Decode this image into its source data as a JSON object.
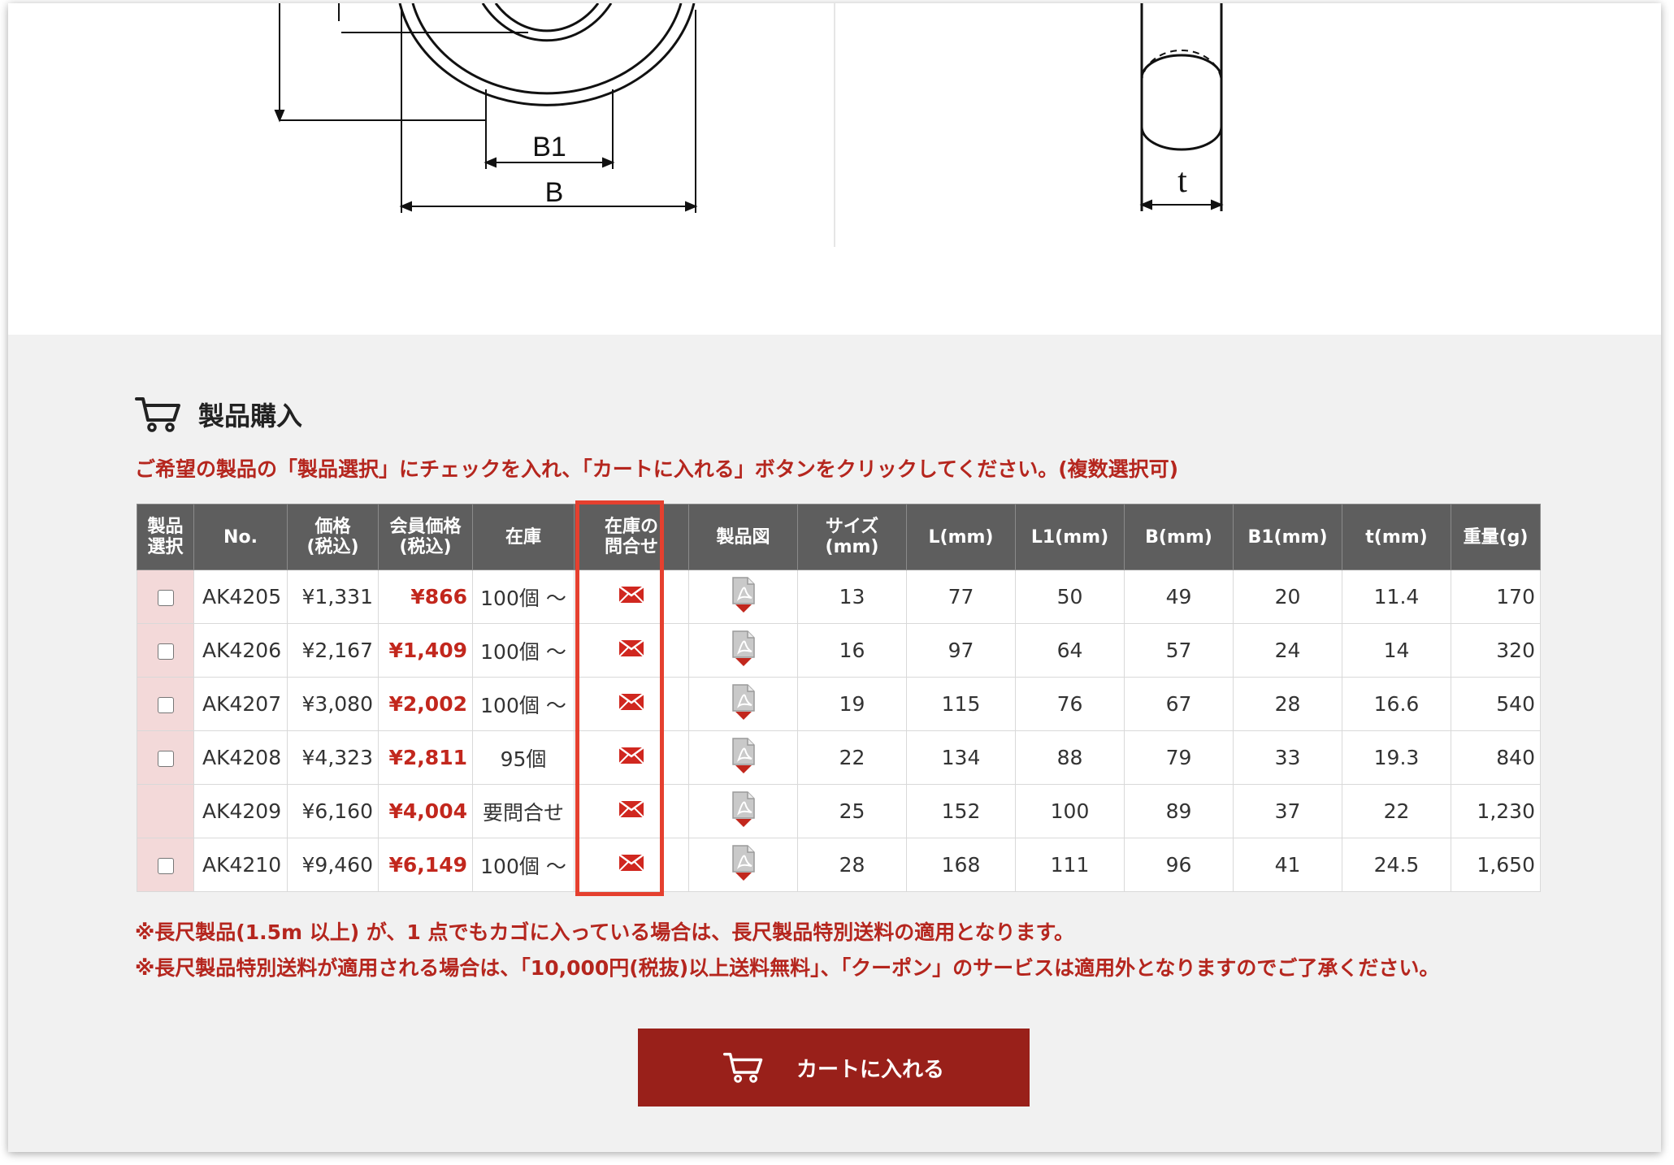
{
  "drawing": {
    "labels": {
      "b1": "B1",
      "b": "B",
      "t": "t"
    }
  },
  "purchase": {
    "heading": "製品購入",
    "instructions": "ご希望の製品の「製品選択」にチェックを入れ、「カートに入れる」ボタンをクリックしてください。(複数選択可)",
    "columns": [
      {
        "line1": "製品",
        "line2": "選択"
      },
      {
        "line1": "No.",
        "line2": ""
      },
      {
        "line1": "価格",
        "line2": "(税込)"
      },
      {
        "line1": "会員価格",
        "line2": "(税込)"
      },
      {
        "line1": "在庫",
        "line2": ""
      },
      {
        "line1": "在庫の",
        "line2": "問合せ"
      },
      {
        "line1": "製品図",
        "line2": ""
      },
      {
        "line1": "サイズ",
        "line2": "(mm)"
      },
      {
        "line1": "L(mm)",
        "line2": ""
      },
      {
        "line1": "L1(mm)",
        "line2": ""
      },
      {
        "line1": "B(mm)",
        "line2": ""
      },
      {
        "line1": "B1(mm)",
        "line2": ""
      },
      {
        "line1": "t(mm)",
        "line2": ""
      },
      {
        "line1": "重量(g)",
        "line2": ""
      }
    ],
    "rows": [
      {
        "has_checkbox": true,
        "no": "AK4205",
        "price": "¥1,331",
        "member_price": "¥866",
        "stock": "100個 ～",
        "size": "13",
        "l": "77",
        "l1": "50",
        "b": "49",
        "b1": "20",
        "t": "11.4",
        "weight": "170"
      },
      {
        "has_checkbox": true,
        "no": "AK4206",
        "price": "¥2,167",
        "member_price": "¥1,409",
        "stock": "100個 ～",
        "size": "16",
        "l": "97",
        "l1": "64",
        "b": "57",
        "b1": "24",
        "t": "14",
        "weight": "320"
      },
      {
        "has_checkbox": true,
        "no": "AK4207",
        "price": "¥3,080",
        "member_price": "¥2,002",
        "stock": "100個 ～",
        "size": "19",
        "l": "115",
        "l1": "76",
        "b": "67",
        "b1": "28",
        "t": "16.6",
        "weight": "540"
      },
      {
        "has_checkbox": true,
        "no": "AK4208",
        "price": "¥4,323",
        "member_price": "¥2,811",
        "stock": "95個",
        "size": "22",
        "l": "134",
        "l1": "88",
        "b": "79",
        "b1": "33",
        "t": "19.3",
        "weight": "840"
      },
      {
        "has_checkbox": false,
        "no": "AK4209",
        "price": "¥6,160",
        "member_price": "¥4,004",
        "stock": "要問合せ",
        "size": "25",
        "l": "152",
        "l1": "100",
        "b": "89",
        "b1": "37",
        "t": "22",
        "weight": "1,230"
      },
      {
        "has_checkbox": true,
        "no": "AK4210",
        "price": "¥9,460",
        "member_price": "¥6,149",
        "stock": "100個 ～",
        "size": "28",
        "l": "168",
        "l1": "111",
        "b": "96",
        "b1": "41",
        "t": "24.5",
        "weight": "1,650"
      }
    ],
    "notes": [
      "※長尺製品(1.5m 以上) が、1 点でもカゴに入っている場合は、長尺製品特別送料の適用となります。",
      "※長尺製品特別送料が適用される場合は、「10,000円(税抜)以上送料無料」、「クーポン」のサービスは適用外となりますのでご了承ください。"
    ],
    "cart_button_label": "カートに入れる"
  },
  "icons": {
    "heading": "cart-icon",
    "inquiry": "mail-icon",
    "drawing": "pdf-download-icon",
    "button": "cart-icon"
  },
  "colors": {
    "accent_red": "#b5261e",
    "button_red": "#99201a",
    "highlight": "#e5402f",
    "header_gray": "#5e5e5e",
    "checkbox_cell": "#f3d9d9"
  }
}
